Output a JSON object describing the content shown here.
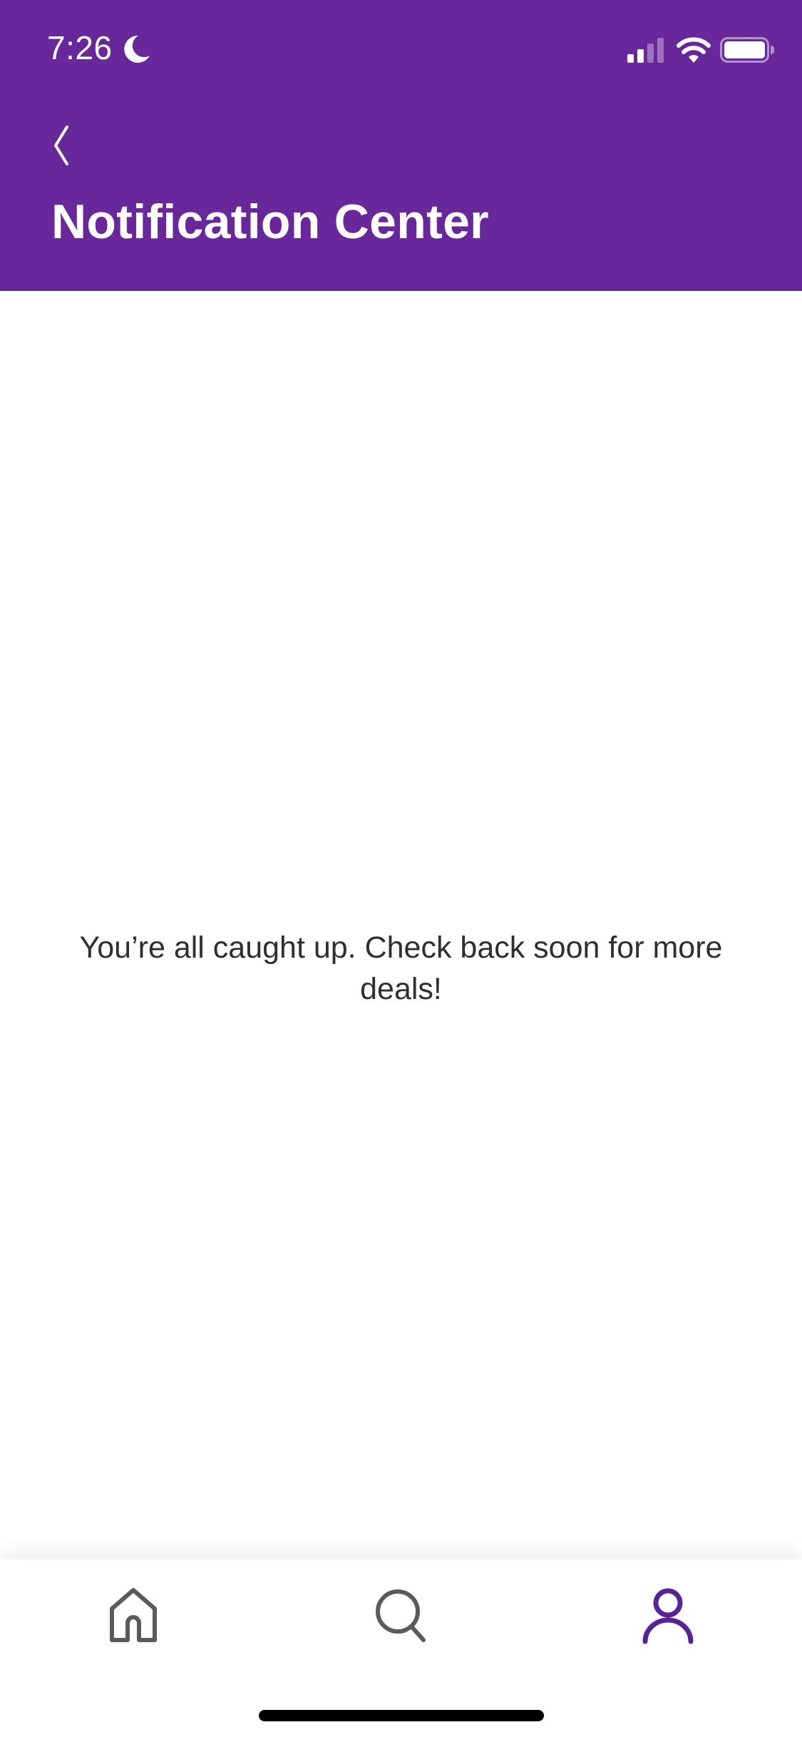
{
  "colors": {
    "brand_purple": "#68279a",
    "active_tab": "#5a2297",
    "inactive_tab": "#5a5a5a",
    "message_text": "#2f2f2f"
  },
  "status_bar": {
    "time": "7:26",
    "focus_icon": "moon-icon",
    "signal_icon": "cellular-signal-icon",
    "wifi_icon": "wifi-icon",
    "battery_icon": "battery-icon"
  },
  "header": {
    "back_icon": "chevron-left-icon",
    "title": "Notification Center"
  },
  "main": {
    "empty_message": "You’re all caught up. Check back soon for more deals!"
  },
  "tab_bar": {
    "tabs": [
      {
        "name": "home",
        "icon": "home-icon",
        "active": false
      },
      {
        "name": "search",
        "icon": "search-icon",
        "active": false
      },
      {
        "name": "account",
        "icon": "person-icon",
        "active": true
      }
    ]
  }
}
